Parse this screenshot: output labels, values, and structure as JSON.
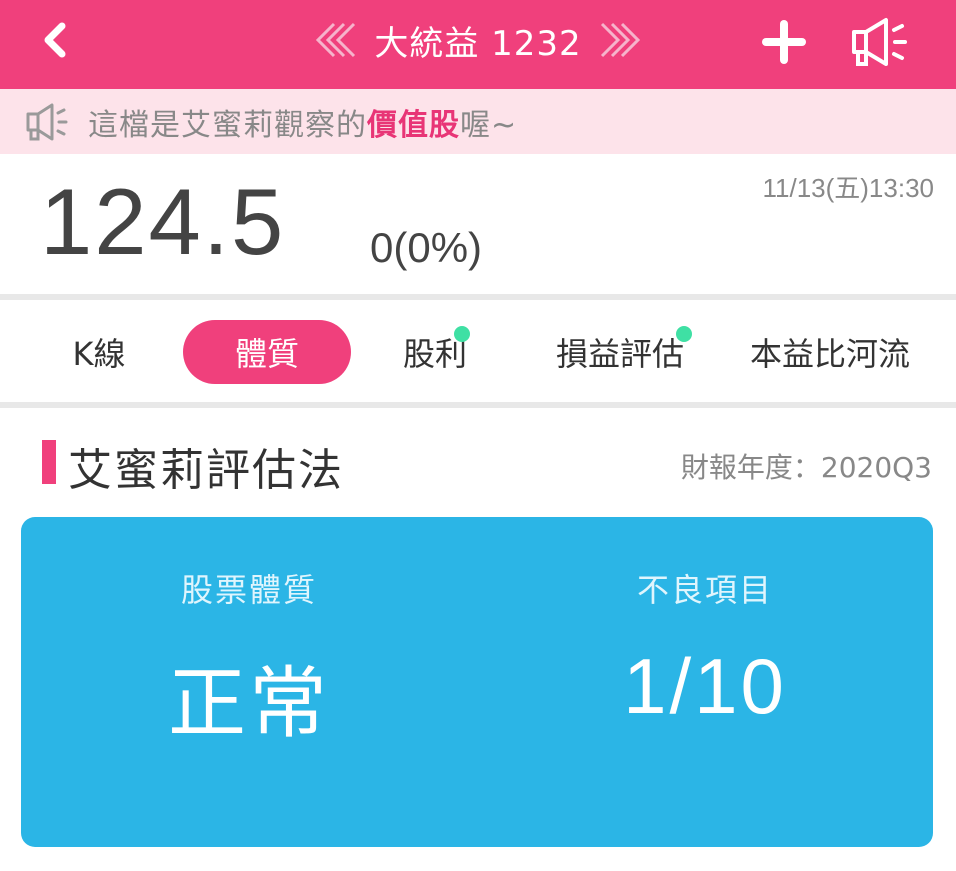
{
  "header": {
    "title": "大統益 1232",
    "icons": [
      "back-arrow-icon",
      "prev-double-chevron-icon",
      "next-double-chevron-icon",
      "add-icon",
      "speaker-icon"
    ],
    "bg_color": "#f0407c"
  },
  "notice": {
    "prefix": "這檔是艾蜜莉觀察的",
    "highlight": "價值股",
    "suffix": "喔~",
    "highlight_color": "#e83576",
    "icon": "speaker-icon"
  },
  "quote": {
    "price": "124.5",
    "change": "0(0%)",
    "datetime": "11/13(五)13:30"
  },
  "tabs": [
    {
      "label": "K線",
      "active": false,
      "has_dot": false
    },
    {
      "label": "體質",
      "active": true,
      "has_dot": false
    },
    {
      "label": "股利",
      "active": false,
      "has_dot": true
    },
    {
      "label": "損益評估",
      "active": false,
      "has_dot": true
    },
    {
      "label": "本益比河流",
      "active": false,
      "has_dot": false
    }
  ],
  "section": {
    "title": "艾蜜莉評估法",
    "meta": "財報年度：2020Q3"
  },
  "card": {
    "bg_color": "#2bb5e6",
    "left": {
      "label": "股票體質",
      "value": "正常"
    },
    "right": {
      "label": "不良項目",
      "value": "1/10"
    }
  }
}
